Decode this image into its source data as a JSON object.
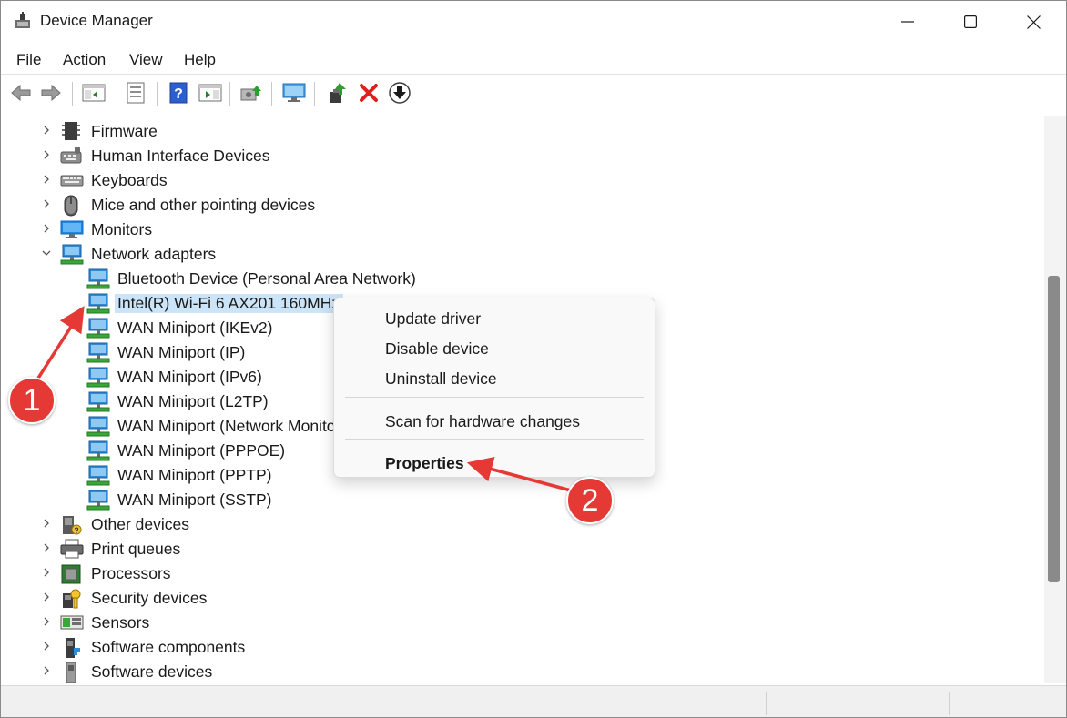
{
  "window": {
    "title": "Device Manager"
  },
  "menu": [
    "File",
    "Action",
    "View",
    "Help"
  ],
  "toolbar_icons": [
    "back-arrow-icon",
    "forward-arrow-icon",
    "show-hide-console-tree-icon",
    "properties-sheet-icon",
    "help-icon",
    "action-pane-icon",
    "scan-hardware-icon",
    "computer-monitor-icon",
    "update-driver-icon",
    "uninstall-device-icon",
    "disable-device-icon"
  ],
  "tree": [
    {
      "label": "Firmware",
      "icon": "firmware-chip-icon",
      "level": 0,
      "state": "collapsed"
    },
    {
      "label": "Human Interface Devices",
      "icon": "hid-icon",
      "level": 0,
      "state": "collapsed"
    },
    {
      "label": "Keyboards",
      "icon": "keyboard-icon",
      "level": 0,
      "state": "collapsed"
    },
    {
      "label": "Mice and other pointing devices",
      "icon": "mouse-icon",
      "level": 0,
      "state": "collapsed"
    },
    {
      "label": "Monitors",
      "icon": "monitor-icon",
      "level": 0,
      "state": "collapsed"
    },
    {
      "label": "Network adapters",
      "icon": "network-adapter-icon",
      "level": 0,
      "state": "expanded"
    },
    {
      "label": "Bluetooth Device (Personal Area Network)",
      "icon": "network-adapter-icon",
      "level": 1
    },
    {
      "label": "Intel(R) Wi-Fi 6 AX201 160MHz",
      "icon": "network-adapter-icon",
      "level": 1,
      "selected": true
    },
    {
      "label": "WAN Miniport (IKEv2)",
      "icon": "network-adapter-icon",
      "level": 1
    },
    {
      "label": "WAN Miniport (IP)",
      "icon": "network-adapter-icon",
      "level": 1
    },
    {
      "label": "WAN Miniport (IPv6)",
      "icon": "network-adapter-icon",
      "level": 1
    },
    {
      "label": "WAN Miniport (L2TP)",
      "icon": "network-adapter-icon",
      "level": 1
    },
    {
      "label": "WAN Miniport (Network Monitor)",
      "icon": "network-adapter-icon",
      "level": 1
    },
    {
      "label": "WAN Miniport (PPPOE)",
      "icon": "network-adapter-icon",
      "level": 1
    },
    {
      "label": "WAN Miniport (PPTP)",
      "icon": "network-adapter-icon",
      "level": 1
    },
    {
      "label": "WAN Miniport (SSTP)",
      "icon": "network-adapter-icon",
      "level": 1
    },
    {
      "label": "Other devices",
      "icon": "other-devices-icon",
      "level": 0,
      "state": "collapsed"
    },
    {
      "label": "Print queues",
      "icon": "printer-icon",
      "level": 0,
      "state": "collapsed"
    },
    {
      "label": "Processors",
      "icon": "processor-icon",
      "level": 0,
      "state": "collapsed"
    },
    {
      "label": "Security devices",
      "icon": "security-device-icon",
      "level": 0,
      "state": "collapsed"
    },
    {
      "label": "Sensors",
      "icon": "sensor-icon",
      "level": 0,
      "state": "collapsed"
    },
    {
      "label": "Software components",
      "icon": "software-component-icon",
      "level": 0,
      "state": "collapsed"
    },
    {
      "label": "Software devices",
      "icon": "software-device-icon",
      "level": 0,
      "state": "collapsed"
    }
  ],
  "context_menu": {
    "items": [
      "Update driver",
      "Disable device",
      "Uninstall device",
      "Scan for hardware changes",
      "Properties"
    ],
    "default_item": "Properties"
  },
  "annotations": [
    {
      "number": "1",
      "target": "Intel(R) Wi-Fi 6 AX201 160MHz"
    },
    {
      "number": "2",
      "target": "Properties"
    }
  ],
  "colors": {
    "selection": "#cce4f7",
    "callout": "#e53935",
    "close-x": "#e0201b",
    "adapter-green": "#3aa63a",
    "monitor-blue": "#1e88e5"
  }
}
